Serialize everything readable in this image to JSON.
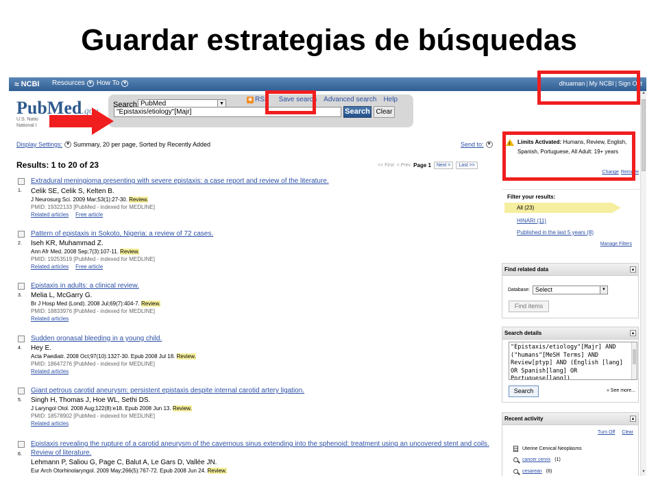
{
  "slide": {
    "title": "Guardar estrategias de búsquedas"
  },
  "ncbi": {
    "logo": "NCBI",
    "menus": [
      "Resources",
      "How To"
    ],
    "user": {
      "name": "dhuaman",
      "my_ncbi": "My NCBI",
      "sign_out": "Sign Out"
    }
  },
  "header": {
    "logo_main": "PubMed",
    "logo_suffix": ".gov",
    "logo_sub_1": "U.S. Natio",
    "logo_sub_2": "National I",
    "search_label": "Search:",
    "database": "PubMed",
    "rss": "RSS",
    "save_search": "Save search",
    "advanced": "Advanced search",
    "help": "Help",
    "query": "\"Epistaxis/etiology\"[Majr]",
    "search_button": "Search",
    "clear_button": "Clear"
  },
  "display": {
    "settings_link": "Display Settings:",
    "settings_text": "Summary, 20 per page, Sorted by Recently Added",
    "send_to": "Send to:"
  },
  "results_title": "Results: 1 to 20 of 23",
  "pager": {
    "first": "<< First",
    "prev": "< Prev",
    "page": "Page 1",
    "next": "Next >",
    "last": "Last >>"
  },
  "results": [
    {
      "num": "1.",
      "title": "Extradural meningioma presenting with severe epistaxis: a case report and review of the literature.",
      "authors": "Celik SE, Celik S, Kelten B.",
      "journal": "J Neurosurg Sci. 2009 Mar;53(1):27-30.",
      "review": "Review.",
      "pmid": "PMID: 19322133 [PubMed - indexed for MEDLINE]",
      "links": [
        "Related articles",
        "Free article"
      ]
    },
    {
      "num": "2.",
      "title": "Pattern of epistaxis in Sokoto, Nigeria: a review of 72 cases.",
      "authors": "Iseh KR, Muhammad Z.",
      "journal": "Ann Afr Med. 2008 Sep;7(3):107-11.",
      "review": "Review.",
      "pmid": "PMID: 19253519 [PubMed - indexed for MEDLINE]",
      "links": [
        "Related articles",
        "Free article"
      ]
    },
    {
      "num": "3.",
      "title": "Epistaxis in adults: a clinical review.",
      "authors": "Melia L, McGarry G.",
      "journal": "Br J Hosp Med (Lond). 2008 Jul;69(7):404-7.",
      "review": "Review.",
      "pmid": "PMID: 18833976 [PubMed - indexed for MEDLINE]",
      "links": [
        "Related articles"
      ]
    },
    {
      "num": "4.",
      "title": "Sudden oronasal bleeding in a young child.",
      "authors": "Hey E.",
      "journal": "Acta Paediatr. 2008 Oct;97(10):1327-30. Epub 2008 Jul 18.",
      "review": "Review.",
      "pmid": "PMID: 18647276 [PubMed - indexed for MEDLINE]",
      "links": [
        "Related articles"
      ]
    },
    {
      "num": "5.",
      "title": "Giant petrous carotid aneurysm: persistent epistaxis despite internal carotid artery ligation.",
      "authors": "Singh H, Thomas J, Hoe WL, Sethi DS.",
      "journal": "J Laryngol Otol. 2008 Aug;122(8):e18. Epub 2008 Jun 13.",
      "review": "Review.",
      "pmid": "PMID: 18578902 [PubMed - indexed for MEDLINE]",
      "links": [
        "Related articles"
      ]
    },
    {
      "num": "6.",
      "title": "Epistaxis revealing the rupture of a carotid aneurysm of the cavernous sinus extending into the sphenoid: treatment using an uncovered stent and coils. Review of literature.",
      "authors": "Lehmann P, Saliou G, Page C, Balut A, Le Gars D, Vallée JN.",
      "journal": "Eur Arch Otorhinolaryngol. 2009 May;266(5):767-72. Epub 2008 Jun 24.",
      "review": "Review.",
      "pmid": "",
      "links": []
    }
  ],
  "limits": {
    "label": "Limits Activated:",
    "text": "Humans, Review, English, Spanish, Portuguese, All Adult: 19+ years",
    "change": "Change",
    "remove": "Remove"
  },
  "filter": {
    "title": "Filter your results:",
    "all": "All (23)",
    "hinari": "HINARI (11)",
    "last5": "Published in the last 5 years (8)",
    "manage": "Manage Filters"
  },
  "related": {
    "title": "Find related data",
    "db_label": "Database:",
    "db_value": "Select",
    "button": "Find items"
  },
  "details": {
    "title": "Search details",
    "text": "\"Epistaxis/etiology\"[Majr] AND (\"humans\"[MeSH Terms] AND Review[ptyp] AND (English [lang] OR Spanish[lang] OR Portuguese[lang])",
    "button": "Search",
    "see_more": "» See more..."
  },
  "recent": {
    "title": "Recent activity",
    "turn_off": "Turn Off",
    "clear": "Clear",
    "items": [
      {
        "icon": "document-icon",
        "text": "Uterine Cervical Neoplasms",
        "count": ""
      },
      {
        "icon": "search-icon",
        "text": "cancer cervix",
        "count": "(1)"
      },
      {
        "icon": "search-icon",
        "text": "cesarean",
        "count": "(6)"
      }
    ]
  },
  "colors": {
    "annotation": "#f01e1e",
    "ncbi_bar": "#2f5e93",
    "link": "#2a4ea5",
    "highlight": "#f8f19e"
  }
}
